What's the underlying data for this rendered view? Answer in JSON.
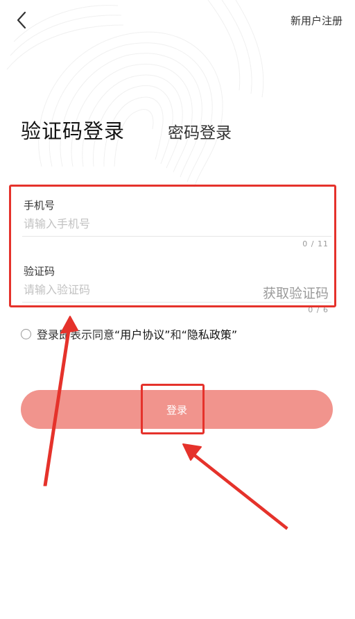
{
  "header": {
    "register_label": "新用户注册"
  },
  "tabs": {
    "active": "验证码登录",
    "inactive": "密码登录"
  },
  "phone": {
    "label": "手机号",
    "placeholder": "请输入手机号",
    "counter": "0 / 11"
  },
  "code": {
    "label": "验证码",
    "placeholder": "请输入验证码",
    "get_code_label": "获取验证码",
    "counter": "0 / 6"
  },
  "agreement": {
    "text_before": "登录即表示同意",
    "user_agreement": "“用户协议”",
    "and": "和",
    "privacy_policy": "“隐私政策”"
  },
  "login_button": {
    "label": "登录"
  },
  "colors": {
    "accent": "#f1948d",
    "annotation": "#e5322b"
  }
}
